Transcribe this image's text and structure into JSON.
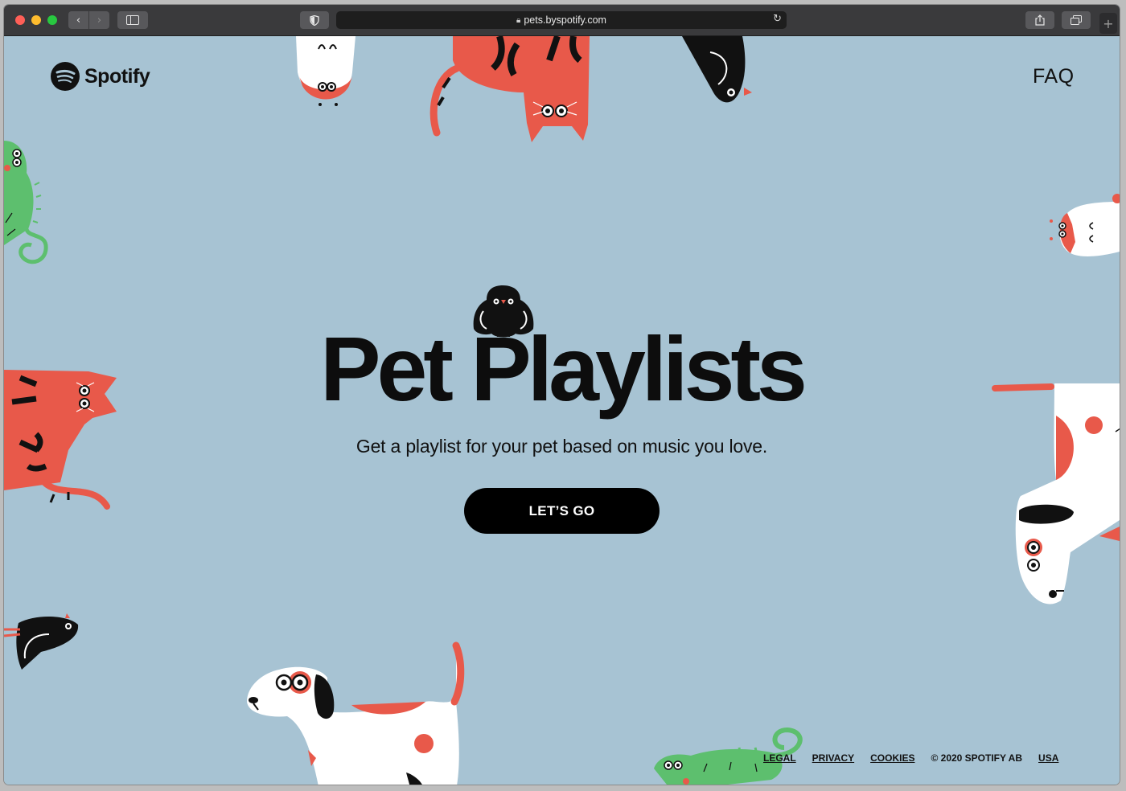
{
  "browser": {
    "url": "pets.byspotify.com",
    "back_icon": "chevron-left-icon",
    "forward_icon": "chevron-right-icon",
    "new_tab_icon": "plus-icon"
  },
  "header": {
    "logo_text": "Spotify",
    "faq_label": "FAQ"
  },
  "hero": {
    "title": "Pet Playlists",
    "subtitle": "Get a playlist for your pet based on music you love.",
    "cta_label": "LET’S GO"
  },
  "footer": {
    "links": [
      "LEGAL",
      "PRIVACY",
      "COOKIES"
    ],
    "copyright": "© 2020 SPOTIFY AB",
    "region": "USA"
  },
  "colors": {
    "background": "#a7c3d3",
    "accent_red": "#e8594a",
    "accent_green": "#5dbf6e",
    "ink": "#0d0d0d"
  }
}
